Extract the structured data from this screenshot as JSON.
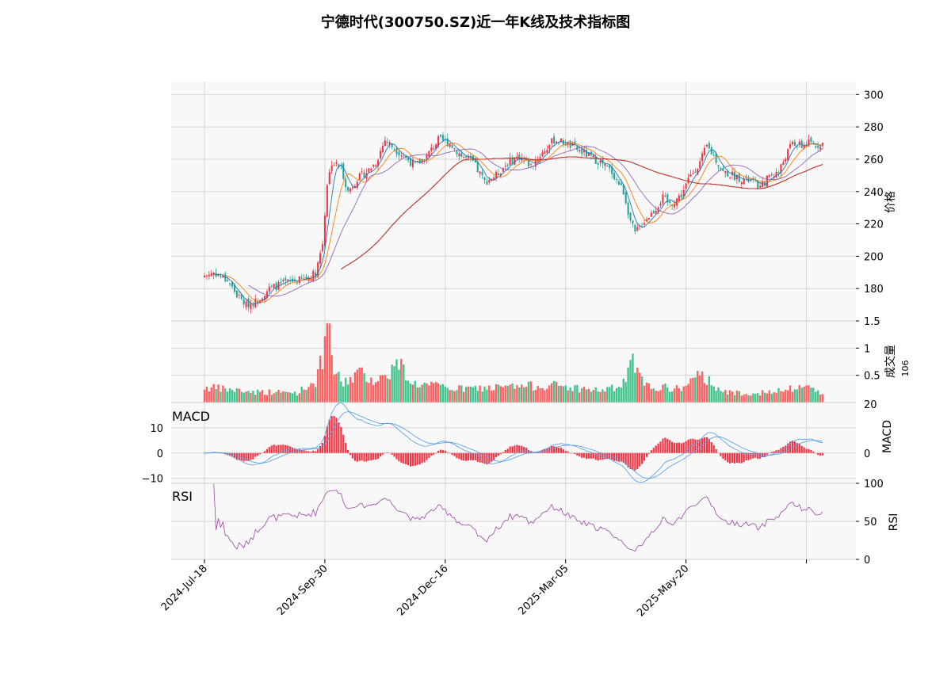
{
  "chart_data": {
    "type": "candlestick",
    "title": "宁德时代(300750.SZ)近一年K线及技术指标图",
    "x_ticks": [
      "2024-Jul-18",
      "2024-Sep-30",
      "2024-Dec-16",
      "2025-Mar-05",
      "2025-May-20"
    ],
    "price": {
      "ylabel": "价格",
      "ylim": [
        160,
        308
      ],
      "yticks": [
        180,
        200,
        220,
        240,
        260,
        280,
        300
      ],
      "close_keypoints": [
        [
          0,
          188
        ],
        [
          4,
          190
        ],
        [
          10,
          185
        ],
        [
          14,
          176
        ],
        [
          18,
          170
        ],
        [
          22,
          172
        ],
        [
          28,
          180
        ],
        [
          36,
          184
        ],
        [
          44,
          186
        ],
        [
          48,
          190
        ],
        [
          51,
          208
        ],
        [
          53,
          245
        ],
        [
          55,
          258
        ],
        [
          59,
          255
        ],
        [
          62,
          240
        ],
        [
          66,
          248
        ],
        [
          70,
          252
        ],
        [
          74,
          258
        ],
        [
          78,
          272
        ],
        [
          81,
          268
        ],
        [
          86,
          262
        ],
        [
          91,
          256
        ],
        [
          96,
          262
        ],
        [
          101,
          272
        ],
        [
          106,
          270
        ],
        [
          111,
          262
        ],
        [
          116,
          258
        ],
        [
          121,
          246
        ],
        [
          126,
          250
        ],
        [
          131,
          258
        ],
        [
          136,
          262
        ],
        [
          141,
          256
        ],
        [
          146,
          264
        ],
        [
          151,
          272
        ],
        [
          156,
          270
        ],
        [
          161,
          266
        ],
        [
          166,
          262
        ],
        [
          171,
          258
        ],
        [
          176,
          252
        ],
        [
          181,
          240
        ],
        [
          184,
          222
        ],
        [
          186,
          214
        ],
        [
          190,
          222
        ],
        [
          194,
          228
        ],
        [
          198,
          236
        ],
        [
          201,
          232
        ],
        [
          206,
          238
        ],
        [
          210,
          250
        ],
        [
          214,
          258
        ],
        [
          217,
          268
        ],
        [
          220,
          262
        ],
        [
          224,
          252
        ],
        [
          228,
          250
        ],
        [
          232,
          248
        ],
        [
          237,
          246
        ],
        [
          240,
          242
        ],
        [
          244,
          250
        ],
        [
          248,
          252
        ],
        [
          251,
          262
        ],
        [
          254,
          270
        ],
        [
          258,
          268
        ],
        [
          261,
          270
        ],
        [
          264,
          268
        ],
        [
          266,
          270
        ]
      ],
      "ma_windows": [
        5,
        10,
        20,
        60,
        120,
        250
      ]
    },
    "volume": {
      "ylabel": "成交量",
      "unit": "10^6",
      "ylim": [
        0,
        1.5
      ],
      "yticks": [
        0.5,
        1.0,
        1.5
      ],
      "keypoints": [
        [
          0,
          0.28
        ],
        [
          20,
          0.2
        ],
        [
          40,
          0.18
        ],
        [
          48,
          0.4
        ],
        [
          52,
          0.95
        ],
        [
          54,
          1.38
        ],
        [
          56,
          0.55
        ],
        [
          60,
          0.35
        ],
        [
          66,
          0.55
        ],
        [
          75,
          0.4
        ],
        [
          84,
          0.72
        ],
        [
          90,
          0.35
        ],
        [
          110,
          0.25
        ],
        [
          130,
          0.28
        ],
        [
          150,
          0.32
        ],
        [
          170,
          0.22
        ],
        [
          180,
          0.28
        ],
        [
          185,
          0.72
        ],
        [
          190,
          0.3
        ],
        [
          205,
          0.25
        ],
        [
          215,
          0.5
        ],
        [
          225,
          0.18
        ],
        [
          245,
          0.18
        ],
        [
          260,
          0.3
        ],
        [
          266,
          0.2
        ]
      ]
    },
    "macd": {
      "label": "MACD",
      "ylabel": "MACD",
      "ylim": [
        -12,
        20
      ],
      "left_yticks": [
        -10,
        0,
        10
      ],
      "right_yticks": [
        0,
        20
      ]
    },
    "rsi": {
      "label": "RSI",
      "ylabel": "RSI",
      "ylim": [
        0,
        100
      ],
      "yticks": [
        0,
        50,
        100
      ],
      "period": 14
    },
    "colors": {
      "up": "#f23645",
      "down": "#26a69a",
      "volume_up": "#ff6262",
      "volume_down": "#41c48d",
      "ma": [
        "#1f77b4",
        "#ff7f0e",
        "#9467bd",
        "#2ca02c",
        "#8c564b",
        "#d62728"
      ],
      "macd_line": "#4c9be8",
      "signal_line": "#4c9be8",
      "rsi_line": "#9b44a6",
      "panel_bg": "#f8f8f8",
      "grid": "#d5d5d5"
    }
  }
}
